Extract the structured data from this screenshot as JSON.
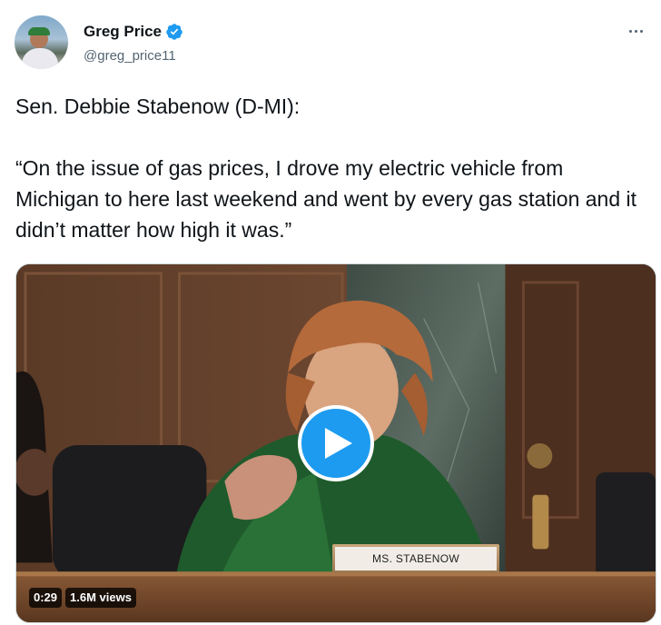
{
  "author": {
    "display_name": "Greg Price",
    "handle": "@greg_price11",
    "verified": true,
    "avatar_icon": "avatar-photo"
  },
  "menu": {
    "icon": "more-options-icon"
  },
  "tweet": {
    "text_line1": "Sen. Debbie Stabenow (D-MI):",
    "text_quote": "“On the issue of gas prices, I drove my electric vehicle from Michigan to here last weekend and went by every gas station and it didn’t matter how high it was.”"
  },
  "video": {
    "duration": "0:29",
    "views": "1.6M views",
    "nameplate": "MS. STABENOW",
    "play_icon": "play-icon"
  },
  "colors": {
    "accent": "#1d9bf0",
    "text": "#0f1419",
    "secondary": "#536471"
  }
}
